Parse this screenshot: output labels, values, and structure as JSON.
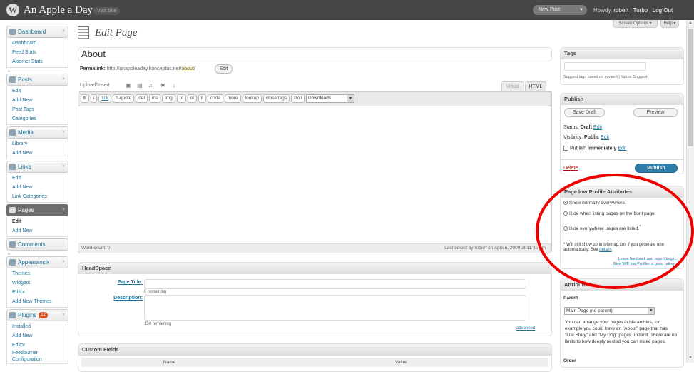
{
  "topbar": {
    "site_title": "An Apple a Day",
    "visit_site": "Visit Site",
    "new_post": "New Post",
    "howdy": "Howdy, ",
    "user": "robert",
    "sep1": " | ",
    "turbo": "Turbo",
    "sep2": " | ",
    "logout": "Log Out"
  },
  "screen_meta": {
    "screen_options": "Screen Options ▾",
    "help": "Help ▾"
  },
  "sidebar": {
    "dashboard": {
      "label": "Dashboard",
      "items": [
        "Dashboard",
        "Feed Stats",
        "Akismet Stats"
      ]
    },
    "posts": {
      "label": "Posts",
      "items": [
        "Edit",
        "Add New",
        "Post Tags",
        "Categories"
      ]
    },
    "media": {
      "label": "Media",
      "items": [
        "Library",
        "Add New"
      ]
    },
    "links": {
      "label": "Links",
      "items": [
        "Edit",
        "Add New",
        "Link Categories"
      ]
    },
    "pages": {
      "label": "Pages",
      "items": [
        "Edit",
        "Add New"
      ]
    },
    "comments": {
      "label": "Comments"
    },
    "appearance": {
      "label": "Appearance",
      "items": [
        "Themes",
        "Widgets",
        "Editor",
        "Add New Themes"
      ]
    },
    "plugins": {
      "label": "Plugins",
      "badge": "12",
      "items": [
        "Installed",
        "Add New",
        "Editor",
        "Feedburner Configuration"
      ]
    }
  },
  "main": {
    "heading": "Edit Page",
    "title_value": "About",
    "permalink": {
      "label": "Permalink:",
      "base": "http://anappleaday.konceptus.net/",
      "slug": "about",
      "trail": "/",
      "edit": "Edit"
    },
    "upload_label": "Upload/Insert",
    "tabs": {
      "visual": "Visual",
      "html": "HTML"
    },
    "quicktags": [
      "b",
      "i",
      "link",
      "b-quote",
      "del",
      "ins",
      "img",
      "ul",
      "ol",
      "li",
      "code",
      "more",
      "lookup",
      "close tags",
      "Poll"
    ],
    "quicktags_select": "Downloads",
    "word_count": "Word count: 0",
    "last_edited": "Last edited by robert on April 6, 2009 at 11:45 pm"
  },
  "headspace": {
    "title": "HeadSpace",
    "page_title_label": "Page Title:",
    "page_title_remaining": "0 remaining",
    "description_label": "Description:",
    "description_remaining": "150 remaining",
    "advanced": "advanced"
  },
  "custom_fields": {
    "title": "Custom Fields",
    "col_name": "Name",
    "col_value": "Value"
  },
  "tags_box": {
    "title": "Tags",
    "hint": "Suggest tags based on content | Yahoo Suggest"
  },
  "publish_box": {
    "title": "Publish",
    "save_draft": "Save Draft",
    "preview": "Preview",
    "status_label": "Status: ",
    "status_value": "Draft",
    "visibility_label": "Visibility: ",
    "visibility_value": "Public",
    "schedule_label": "Publish ",
    "schedule_value": "immediately",
    "edit": "Edit",
    "delete": "Delete",
    "publish": "Publish"
  },
  "pagelow_box": {
    "title": "Page low Profile Attributes",
    "options": [
      "Show normally everywhere.",
      "Hide when listing pages on the front page.",
      "Hide everywhere pages are listed."
    ],
    "note": "* Will still show up in sitemap.xml if you generate one automatically. See ",
    "note_link": "details",
    "feedback": "Leave feedback and report bugs...",
    "rate": "Give 'WP low Profiler' a good rating..."
  },
  "attributes_box": {
    "title": "Attributes",
    "parent_label": "Parent",
    "parent_value": "Main Page (no parent)",
    "help": "You can arrange your pages in hierarchies, for example you could have an \"About\" page that has \"Life Story\" and \"My Dog\" pages under it. There are no limits to how deeply nested you can make pages.",
    "order_label": "Order"
  },
  "colors": {
    "topbar": "#464646",
    "link": "#21759b",
    "publish": "#2e7ca8",
    "annotation_circle": "#e00000"
  }
}
